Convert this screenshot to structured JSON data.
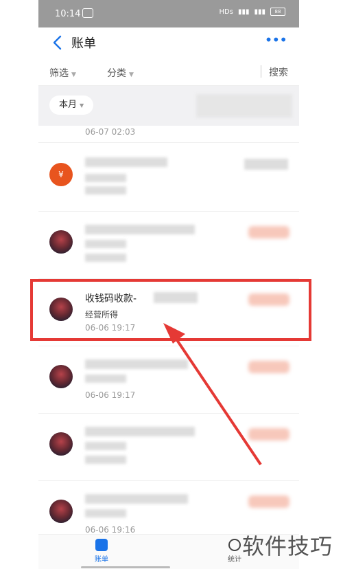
{
  "status_bar": {
    "time": "10:14",
    "network": "HDs",
    "battery": "88"
  },
  "header": {
    "title": "账单"
  },
  "filters": {
    "filter_label": "筛选",
    "category_label": "分类",
    "search_label": "搜索"
  },
  "month": {
    "label": "本月"
  },
  "rows": [
    {
      "time": "06-07  02:03"
    },
    {
      "title": "",
      "sub": "",
      "time": ""
    },
    {
      "title": "",
      "sub": "",
      "time": ""
    },
    {
      "title": "收钱码收款-",
      "sub": "经营所得",
      "time": "06-06  19:17"
    },
    {
      "title": "",
      "sub": "",
      "time": "06-06  19:17"
    },
    {
      "title": "",
      "sub": "",
      "time": ""
    },
    {
      "title": "",
      "sub": "",
      "time": "06-06  19:16"
    }
  ],
  "avatar_bag_symbol": "¥",
  "tabs": [
    {
      "label": "账单"
    },
    {
      "label": "统计"
    }
  ],
  "watermark": "软件技巧",
  "colors": {
    "accent": "#1a73e8",
    "highlight": "#e53935",
    "bag": "#e8541e"
  }
}
